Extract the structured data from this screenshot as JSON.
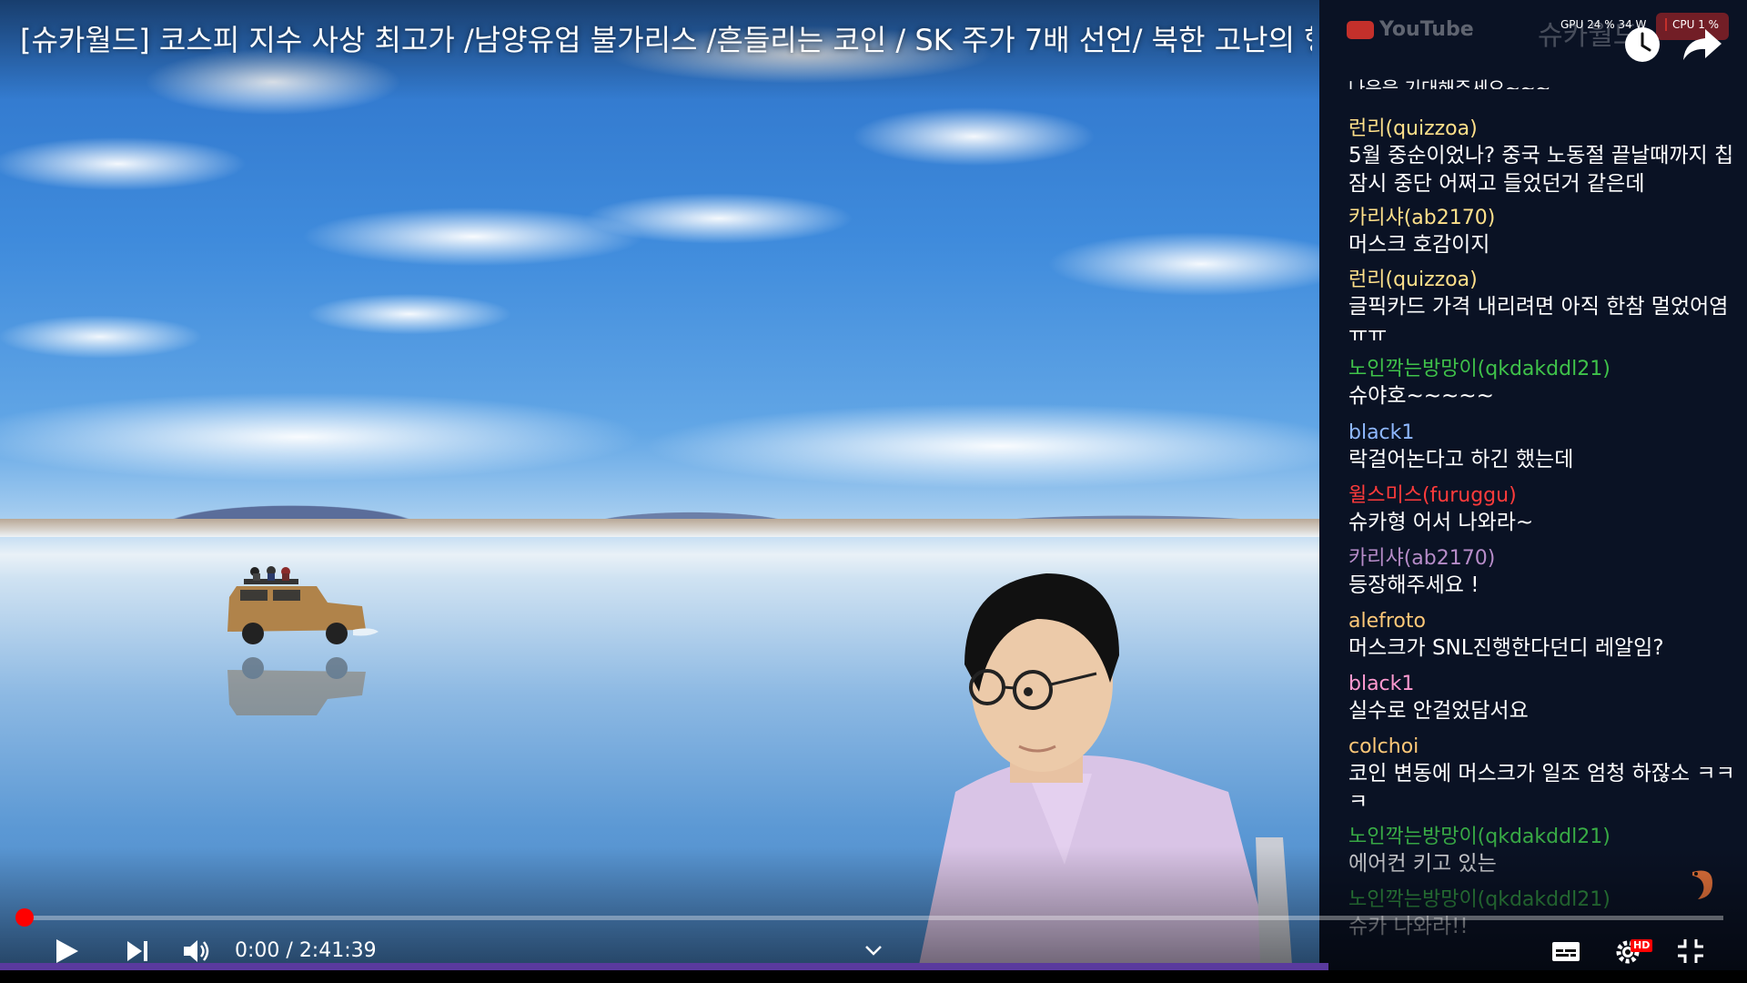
{
  "video": {
    "title": "[슈카월드] 코스피 지수 사상 최고가 /남양유업 불가리스 /흔들리는 코인 / SK 주가 7배 선언/ 북한 고난의 행군/ 리만가설"
  },
  "overlay": {
    "youtube_logo": "YouTube",
    "channel_ghost": "슈카월드",
    "gpu": "GPU 24 % 34 W",
    "cpu": "CPU 1 %"
  },
  "chat": {
    "cutoff_text": "나음을 기대해주세요~~~",
    "messages": [
      {
        "user": "런리(quizzoa)",
        "color": "#ffe08a",
        "text": "5월 중순이었나? 중국 노동절 끝날때까지 칩 잠시 중단 어쩌고 들었던거 같은데"
      },
      {
        "user": "카리샤(ab2170)",
        "color": "#ffe08a",
        "text": "머스크 호감이지"
      },
      {
        "user": "런리(quizzoa)",
        "color": "#ffe08a",
        "text": "글픽카드 가격 내리려면 아직 한참 멀었어염 ㅠㅠ"
      },
      {
        "user": "노인깍는방망이(qkdakddl21)",
        "color": "#3fc24a",
        "text": "슈야호~~~~~"
      },
      {
        "user": "black1",
        "color": "#8fb8ff",
        "text": "락걸어논다고 하긴 했는데"
      },
      {
        "user": "윌스미스(furuggu)",
        "color": "#ff3b3b",
        "text": "슈카형 어서 나와라~"
      },
      {
        "user": "카리샤(ab2170)",
        "color": "#b78cc9",
        "text": "등장해주세요 !"
      },
      {
        "user": "alefroto",
        "color": "#ffc878",
        "text": "머스크가 SNL진행한다던디 레알임?"
      },
      {
        "user": "black1",
        "color": "#ff9ad0",
        "text": "실수로 안걸었담서요"
      },
      {
        "user": "colchoi",
        "color": "#ffc878",
        "text": "코인 변동에 머스크가 일조 엄청 하잖소 ㅋㅋ ㅋ"
      },
      {
        "user": "노인깍는방망이(qkdakddl21)",
        "color": "#3fc24a",
        "text": "에어컨 키고 있는"
      },
      {
        "user": "노인깍는방망이(qkdakddl21)",
        "color": "#3fc24a",
        "text": "슈카 나와라!!"
      }
    ]
  },
  "controls": {
    "time_current": "0:00",
    "time_separator": " / ",
    "time_total": "2:41:39",
    "progress_fraction": 0,
    "hd_badge": "HD"
  }
}
